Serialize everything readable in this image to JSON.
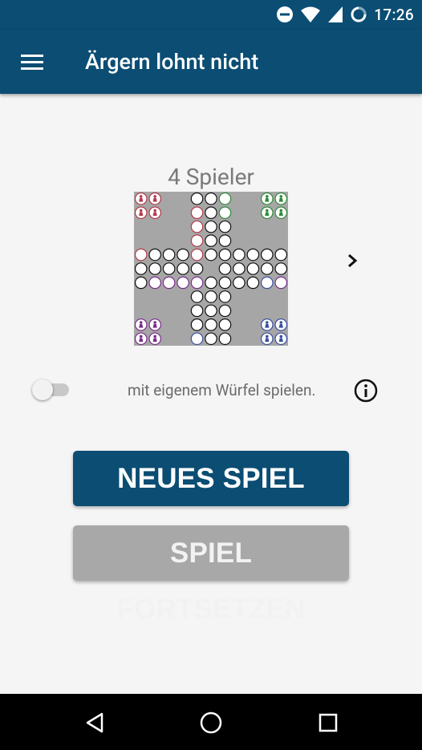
{
  "status_bar": {
    "time": "17:26",
    "icons": [
      "do-not-disturb-icon",
      "wifi-icon",
      "signal-icon",
      "battery-charging-icon"
    ]
  },
  "app_bar": {
    "title": "Ärgern lohnt nicht",
    "menu_icon": "hamburger-menu-icon"
  },
  "game_setup": {
    "players_label": "4 Spieler",
    "next_icon": "chevron-right-icon",
    "own_dice": {
      "label": "mit eigenem Würfel spielen.",
      "enabled": false
    },
    "info_icon": "info-icon"
  },
  "buttons": {
    "new_game": "NEUES SPIEL",
    "continue_game": "SPIEL FORTSETZEN"
  },
  "colors": {
    "primary": "#0b4d73",
    "board_gray": "#a6a6a6",
    "red": "#b23a4a",
    "green": "#2f8a3a",
    "blue": "#3a4fa0",
    "purple": "#7a2d8c",
    "disabled_button": "#a8a8a8"
  },
  "nav_bar": {
    "icons": [
      "back-icon",
      "home-icon",
      "recents-icon"
    ]
  }
}
